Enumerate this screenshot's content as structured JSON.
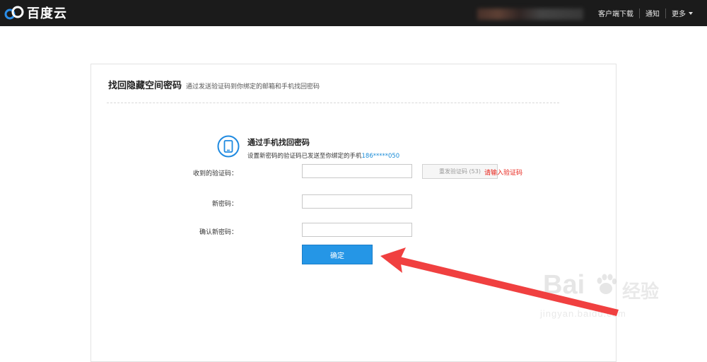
{
  "header": {
    "brand": "百度云",
    "nav": [
      "客户端下载",
      "通知",
      "更多"
    ]
  },
  "page": {
    "title": "找回隐藏空间密码",
    "subtitle": "通过发送验证码到你绑定的邮箱和手机找回密码"
  },
  "section": {
    "title": "通过手机找回密码",
    "desc_prefix": "设置新密码的验证码已发送至你绑定的手机",
    "phone": "186*****050"
  },
  "form": {
    "code_label": "收到的验证码：",
    "resend_label": "重发验证码 (53)",
    "code_error": "请输入验证码",
    "new_password_label": "新密码：",
    "confirm_password_label": "确认新密码：",
    "submit_label": "确定"
  },
  "watermark": {
    "brand": "Bai",
    "brand_cn": "经验",
    "url": "jingyan.baidu.com"
  },
  "colors": {
    "topbar": "#1b1b1b",
    "accent": "#2596e6",
    "error": "#e8231a",
    "arrow": "#f04040"
  }
}
